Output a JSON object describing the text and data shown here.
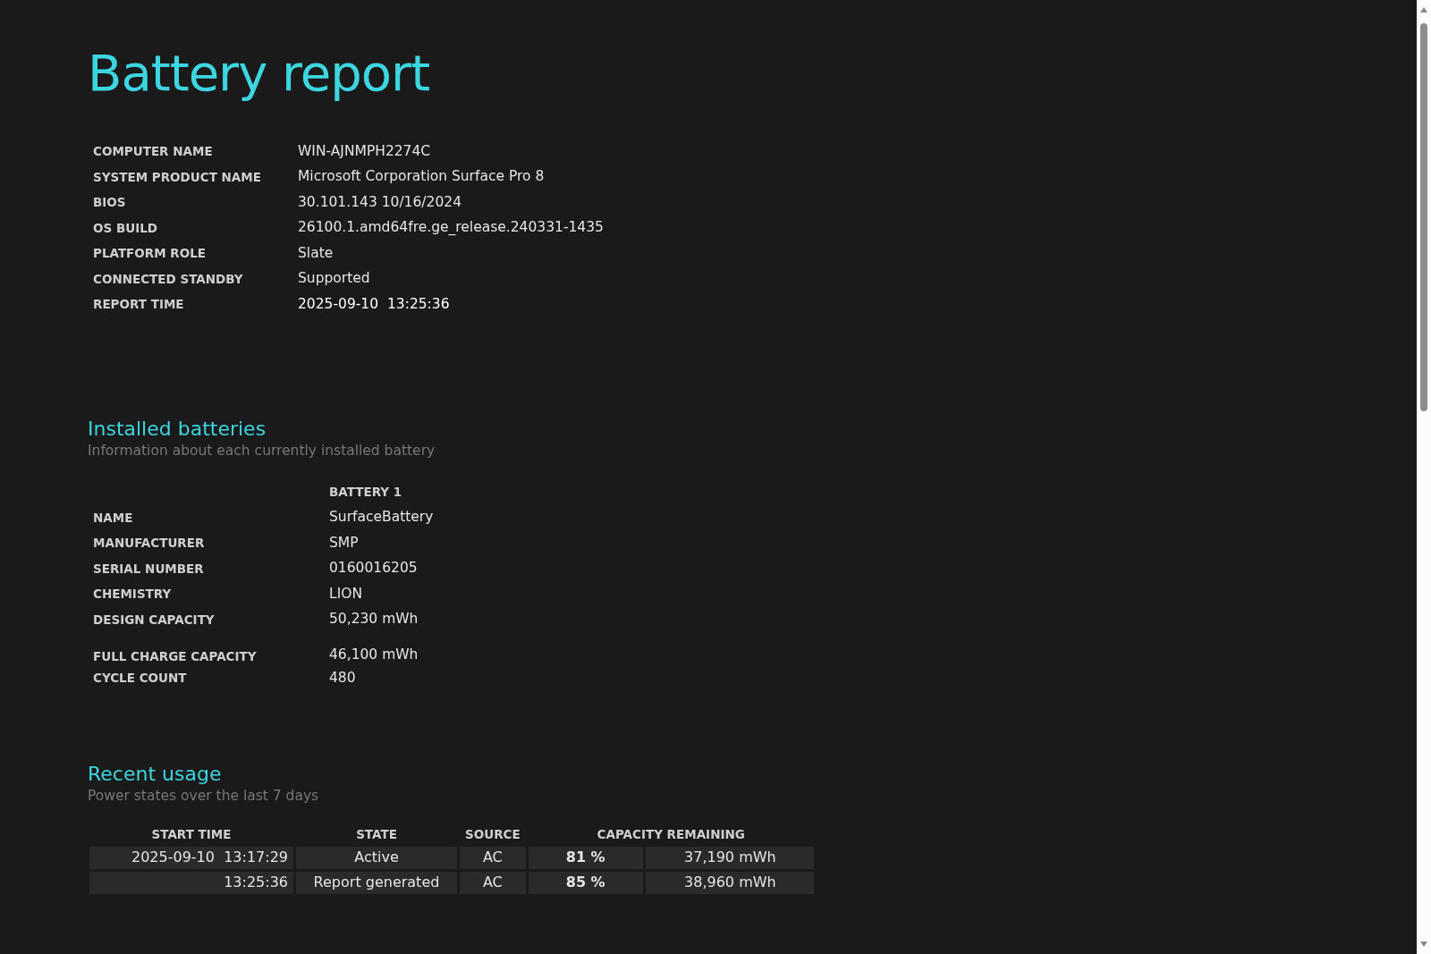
{
  "title": "Battery report",
  "system_info": [
    {
      "label": "COMPUTER NAME",
      "value": "WIN-AJNMPH2274C"
    },
    {
      "label": "SYSTEM PRODUCT NAME",
      "value": "Microsoft Corporation Surface Pro 8"
    },
    {
      "label": "BIOS",
      "value": "30.101.143 10/16/2024"
    },
    {
      "label": "OS BUILD",
      "value": "26100.1.amd64fre.ge_release.240331-1435"
    },
    {
      "label": "PLATFORM ROLE",
      "value": "Slate"
    },
    {
      "label": "CONNECTED STANDBY",
      "value": "Supported"
    },
    {
      "label": "REPORT TIME",
      "value": "2025-09-10  13:25:36"
    }
  ],
  "installed_batteries": {
    "heading": "Installed batteries",
    "subtitle": "Information about each currently installed battery",
    "column": "BATTERY 1",
    "rows": [
      {
        "label": "NAME",
        "value": "SurfaceBattery"
      },
      {
        "label": "MANUFACTURER",
        "value": "SMP"
      },
      {
        "label": "SERIAL NUMBER",
        "value": "0160016205"
      },
      {
        "label": "CHEMISTRY",
        "value": "LION"
      },
      {
        "label": "DESIGN CAPACITY",
        "value": "50,230 mWh"
      },
      {
        "label": "FULL CHARGE CAPACITY",
        "value": "46,100 mWh"
      },
      {
        "label": "CYCLE COUNT",
        "value": "480"
      }
    ]
  },
  "recent_usage": {
    "heading": "Recent usage",
    "subtitle": "Power states over the last 7 days",
    "columns": [
      "START TIME",
      "STATE",
      "SOURCE",
      "CAPACITY REMAINING"
    ],
    "rows": [
      {
        "start_time": "2025-09-10  13:17:29",
        "state": "Active",
        "source": "AC",
        "percent": "81 %",
        "energy": "37,190 mWh"
      },
      {
        "start_time": "13:25:36",
        "state": "Report generated",
        "source": "AC",
        "percent": "85 %",
        "energy": "38,960 mWh"
      }
    ]
  }
}
